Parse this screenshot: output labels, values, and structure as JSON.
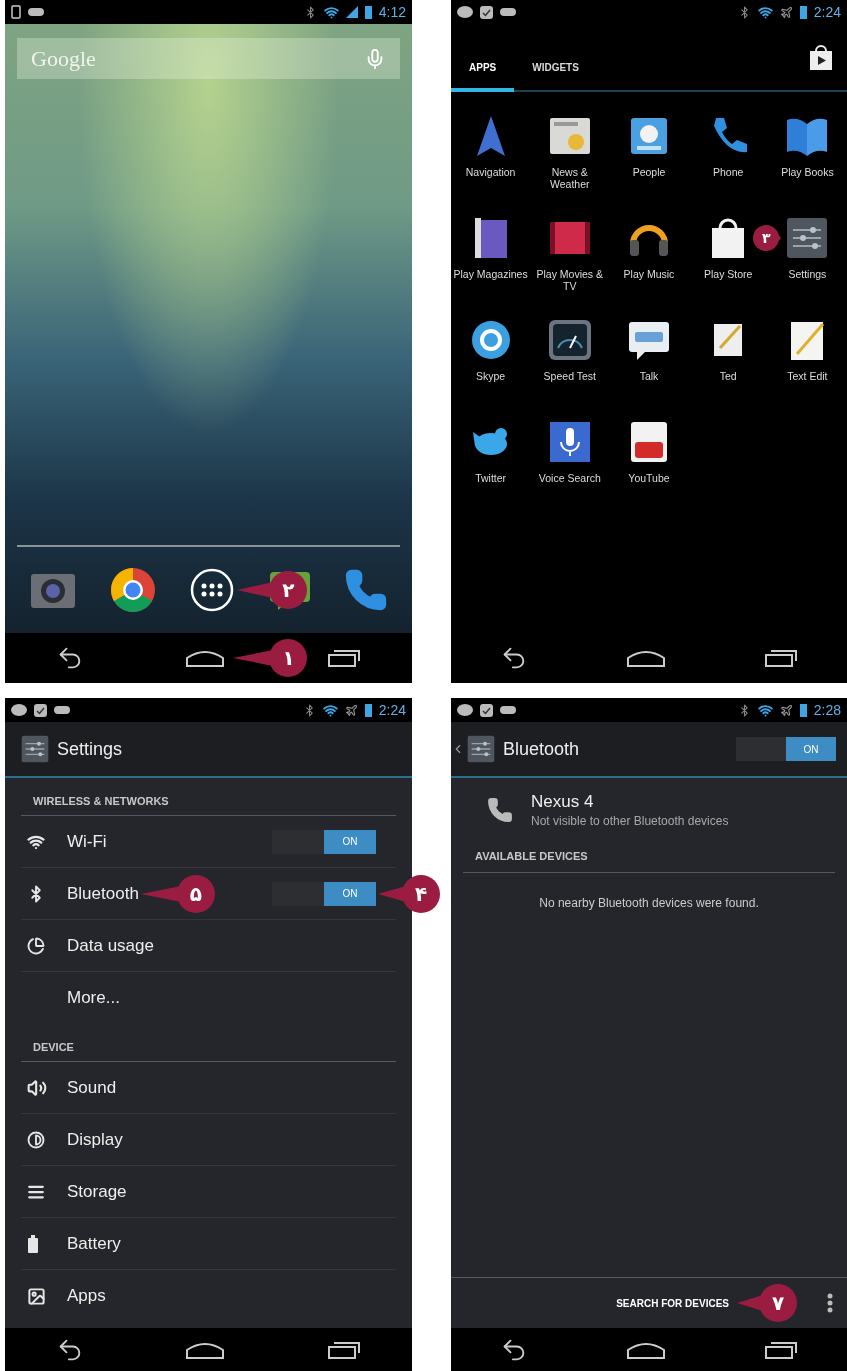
{
  "screens": [
    {
      "kind": "home",
      "status": {
        "notifications": [
          {
            "kind": "device"
          },
          {
            "kind": "game"
          }
        ],
        "airplane": false,
        "time": "4:12"
      },
      "search": {
        "placeholder": "Google"
      },
      "dock": [
        {
          "kind": "camera"
        },
        {
          "kind": "chrome"
        },
        {
          "kind": "launcher",
          "callout": "۲"
        },
        {
          "kind": "messaging"
        },
        {
          "kind": "phone"
        }
      ],
      "home_callout": "۱"
    },
    {
      "kind": "drawer",
      "status": {
        "notifications": [
          {
            "kind": "chat"
          },
          {
            "kind": "check"
          },
          {
            "kind": "game"
          }
        ],
        "airplane": true,
        "time": "2:24"
      },
      "tabs": [
        {
          "label": "APPS",
          "selected": true
        },
        {
          "label": "WIDGETS",
          "selected": false
        }
      ],
      "apps": [
        {
          "label": "Navigation",
          "kind": "navigation"
        },
        {
          "label": "News & Weather",
          "kind": "news"
        },
        {
          "label": "People",
          "kind": "people"
        },
        {
          "label": "Phone",
          "kind": "phone"
        },
        {
          "label": "Play Books",
          "kind": "books"
        },
        {
          "label": "Play Magazines",
          "kind": "magazines"
        },
        {
          "label": "Play Movies & TV",
          "kind": "movies"
        },
        {
          "label": "Play Music",
          "kind": "music"
        },
        {
          "label": "Play Store",
          "kind": "store"
        },
        {
          "label": "Settings",
          "kind": "settings",
          "callout": "۳"
        },
        {
          "label": "Skype",
          "kind": "skype"
        },
        {
          "label": "Speed Test",
          "kind": "speed"
        },
        {
          "label": "Talk",
          "kind": "talk"
        },
        {
          "label": "Ted",
          "kind": "notepad"
        },
        {
          "label": "Text Edit",
          "kind": "textedit"
        },
        {
          "label": "Twitter",
          "kind": "bird"
        },
        {
          "label": "Voice Search",
          "kind": "mic"
        },
        {
          "label": "YouTube",
          "kind": "youtube"
        }
      ]
    },
    {
      "kind": "settings",
      "status": {
        "notifications": [
          {
            "kind": "chat"
          },
          {
            "kind": "check"
          },
          {
            "kind": "game"
          }
        ],
        "airplane": true,
        "time": "2:24"
      },
      "title": "Settings",
      "sections": [
        {
          "header": "WIRELESS & NETWORKS",
          "items": [
            {
              "label": "Wi-Fi",
              "kind": "wifi",
              "toggle": {
                "on": true,
                "label": "ON"
              }
            },
            {
              "label": "Bluetooth",
              "kind": "bluetooth",
              "callout": "۵",
              "toggle": {
                "on": true,
                "label": "ON",
                "callout": "۴"
              }
            },
            {
              "label": "Data usage",
              "kind": "data"
            },
            {
              "label": "More..."
            }
          ]
        },
        {
          "header": "DEVICE",
          "items": [
            {
              "label": "Sound",
              "kind": "sound"
            },
            {
              "label": "Display",
              "kind": "display"
            },
            {
              "label": "Storage",
              "kind": "storage"
            },
            {
              "label": "Battery",
              "kind": "battery"
            },
            {
              "label": "Apps",
              "kind": "apps"
            }
          ]
        }
      ]
    },
    {
      "kind": "bluetooth",
      "status": {
        "notifications": [
          {
            "kind": "chat"
          },
          {
            "kind": "check"
          },
          {
            "kind": "game"
          }
        ],
        "airplane": true,
        "time": "2:28"
      },
      "title": "Bluetooth",
      "toggle": {
        "on": true,
        "label": "ON"
      },
      "device": {
        "name": "Nexus 4",
        "status": "Not visible to other Bluetooth devices"
      },
      "section_header": "AVAILABLE DEVICES",
      "empty_message": "No nearby Bluetooth devices were found.",
      "action": {
        "label": "SEARCH FOR DEVICES",
        "callout": "۷"
      }
    }
  ]
}
